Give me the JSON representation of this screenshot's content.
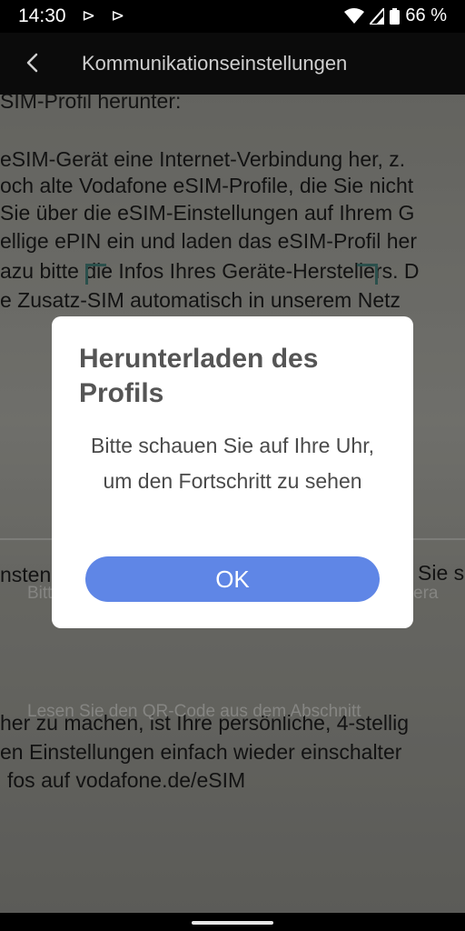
{
  "status_bar": {
    "time": "14:30",
    "app_icons": "⊳ ⊳",
    "battery_percent": "66 %",
    "icons": [
      "notification-icon",
      "notification-icon",
      "wifi-icon",
      "signal-icon",
      "battery-icon"
    ]
  },
  "app_bar": {
    "title": "Kommunikationseinstellungen",
    "back_icon": "chevron-left-icon"
  },
  "camera": {
    "paper_lines": [
      "SIM-Profil herunter:",
      "eSIM-Gerät eine Internet-Verbindung her, z.",
      "och alte Vodafone eSIM-Profile, die Sie nicht",
      "Sie über die eSIM-Einstellungen auf Ihrem G",
      "ellige ePIN ein und laden das eSIM-Profil her",
      "azu bitte die Infos Ihres Geräte-Herstellers. D",
      "e Zusatz-SIM automatisch in unserem Netz",
      "nsten",
      "Sie s",
      "her zu machen, ist Ihre persönliche, 4-stellig",
      "en Einstellungen einfach wieder einschalter",
      "fos auf vodafone.de/eSIM"
    ],
    "overlay_left": "Bitt",
    "overlay_right": "era",
    "overlay_bottom": "Lesen Sie den QR-Code aus dem Abschnitt"
  },
  "dialog": {
    "title": "Herunterladen des Profils",
    "message": "Bitte schauen Sie auf Ihre Uhr, um den Fortschritt zu sehen",
    "ok_label": "OK"
  },
  "colors": {
    "ok_button": "#5f86e6",
    "dialog_bg": "#ffffff",
    "scan_corner": "#3c6f6a"
  }
}
